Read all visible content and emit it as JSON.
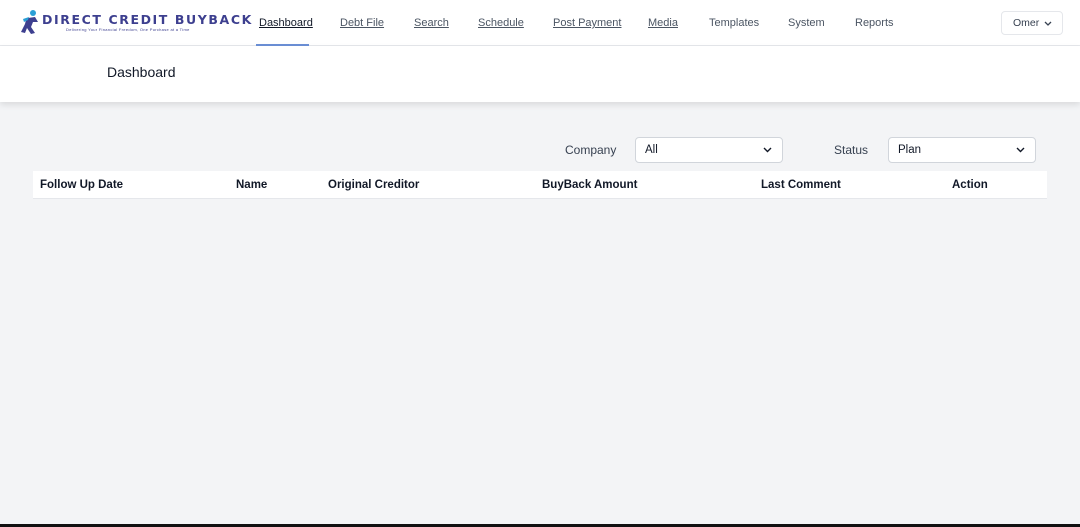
{
  "brand": {
    "name": "DIRECT CREDIT BUYBACK",
    "tagline": "Delivering Your Financial Freedom, One Purchase at a Time",
    "primary_color": "#3d3f8f",
    "accent_color": "#2a9fd6"
  },
  "nav": {
    "items": [
      {
        "label": "Dashboard",
        "active": true
      },
      {
        "label": "Debt File"
      },
      {
        "label": "Search"
      },
      {
        "label": "Schedule"
      },
      {
        "label": "Post Payment"
      },
      {
        "label": "Media"
      },
      {
        "label": "Templates"
      },
      {
        "label": "System"
      },
      {
        "label": "Reports"
      }
    ],
    "active_underline_color": "#6b8fd6"
  },
  "user_menu": {
    "label": "Omer",
    "icon": "chevron-down-icon"
  },
  "page": {
    "title": "Dashboard"
  },
  "filters": {
    "company": {
      "label": "Company",
      "value": "All",
      "icon": "chevron-down-icon"
    },
    "status": {
      "label": "Status",
      "value": "Plan",
      "icon": "chevron-down-icon"
    }
  },
  "table": {
    "columns": [
      "Follow Up Date",
      "Name",
      "Original Creditor",
      "BuyBack Amount",
      "Last Comment",
      "Action"
    ],
    "rows": []
  }
}
